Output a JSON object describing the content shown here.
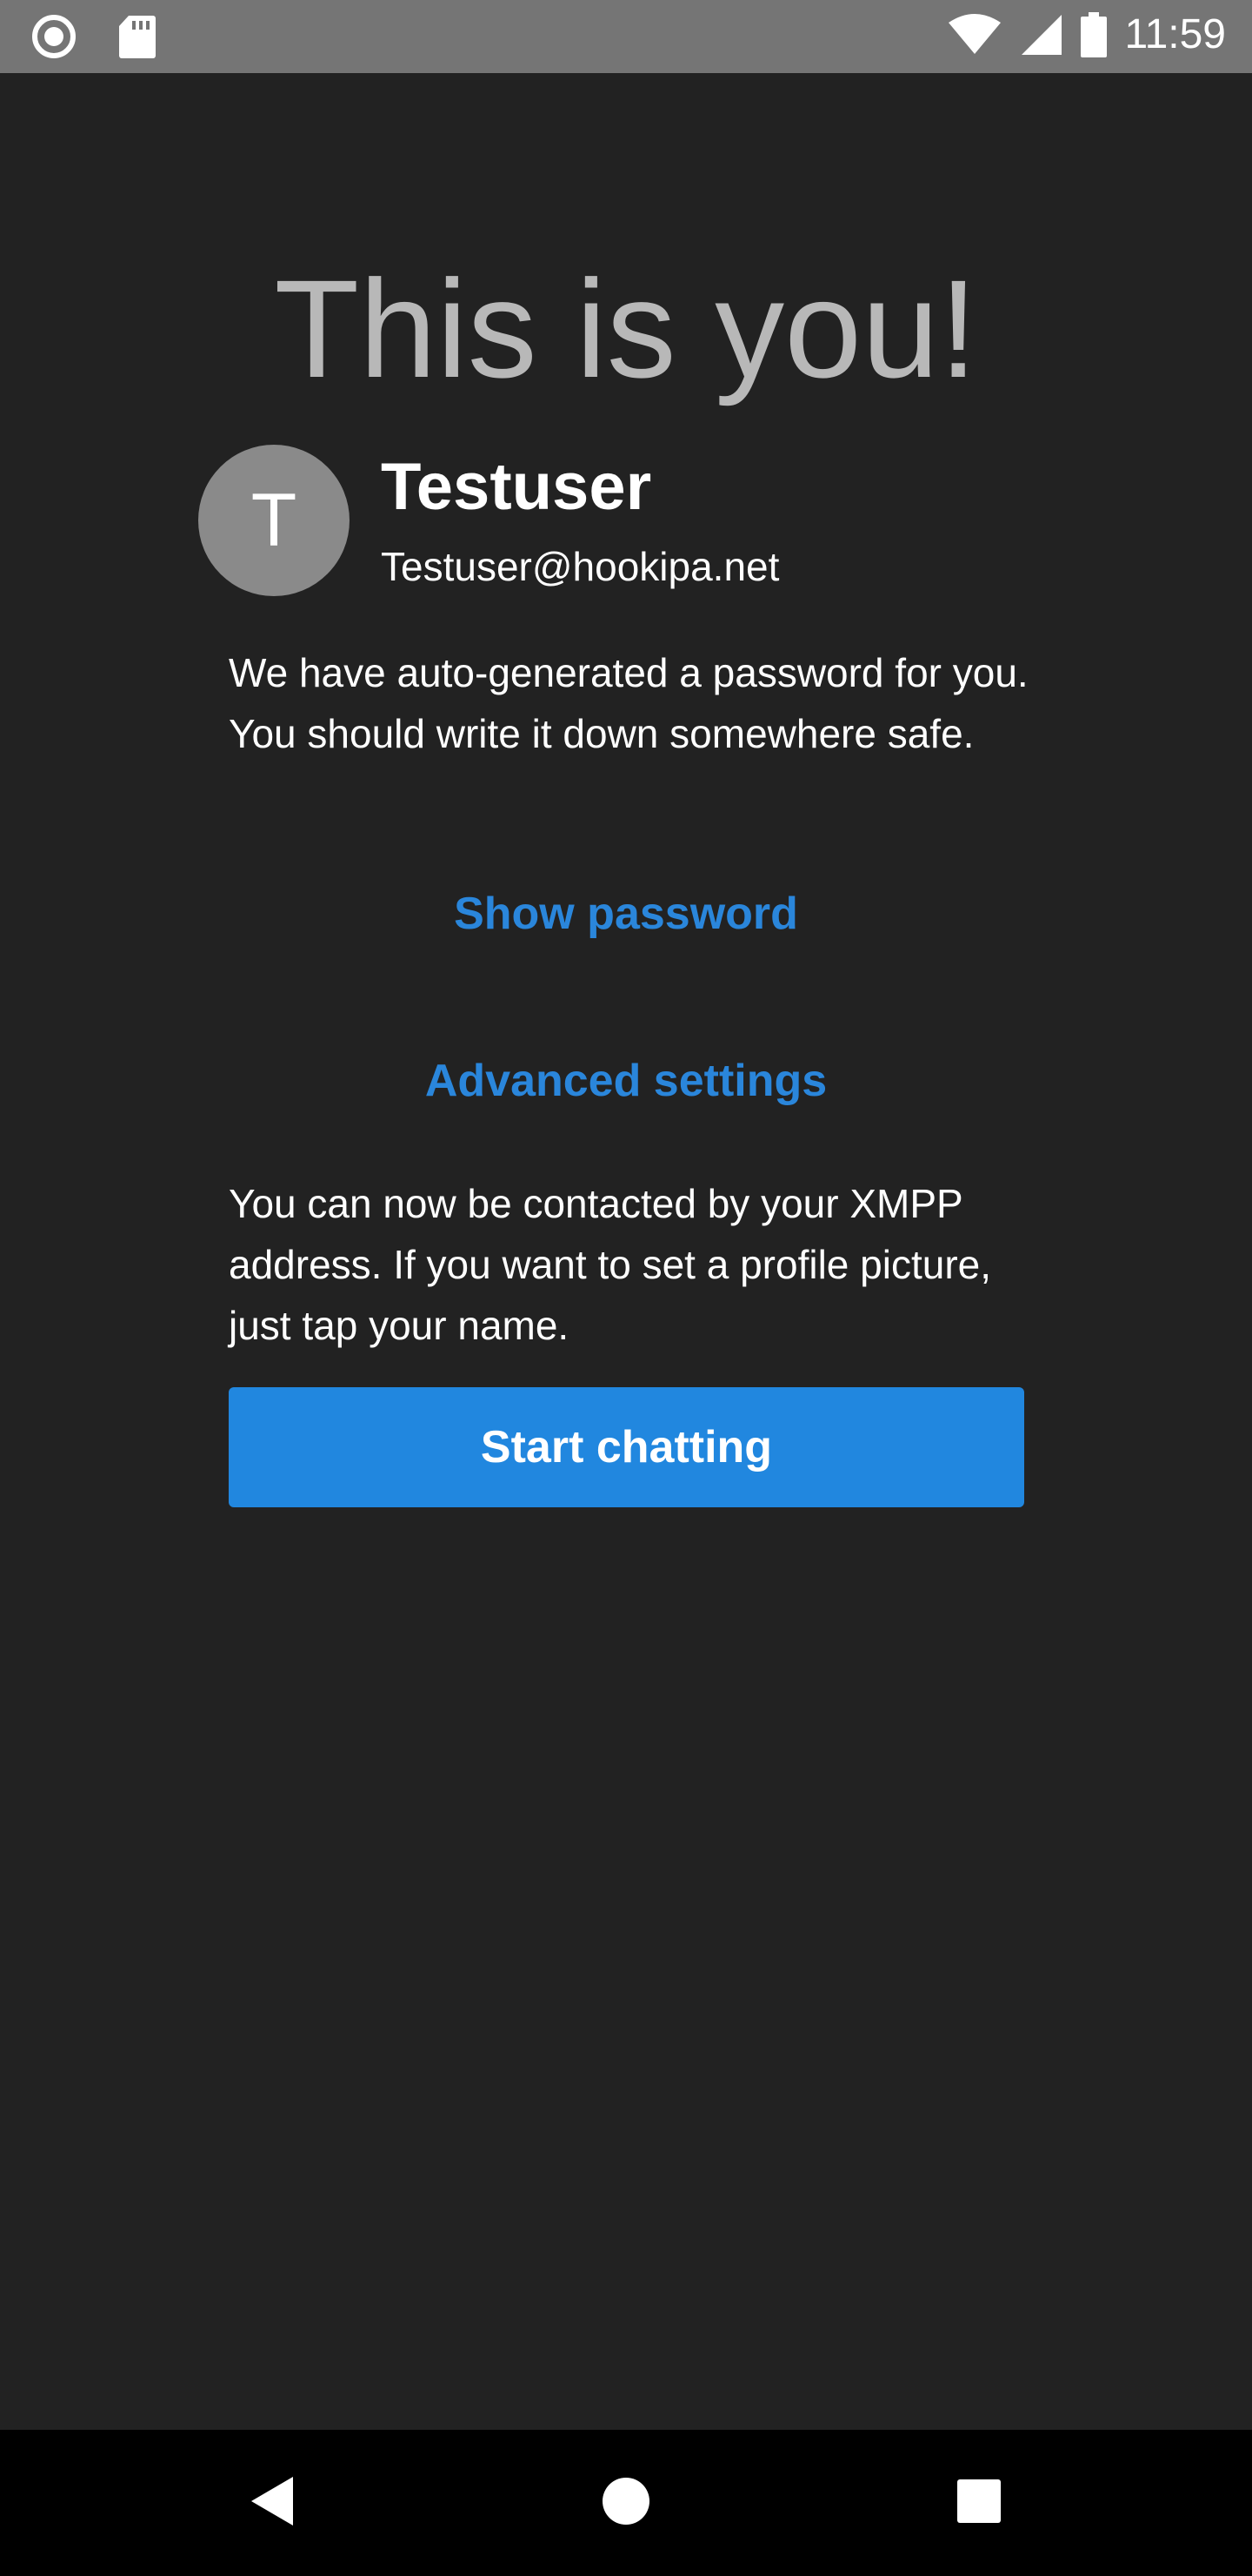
{
  "status_bar": {
    "time": "11:59",
    "icons": [
      "record-icon",
      "sd-card-icon",
      "wifi-icon",
      "signal-icon",
      "battery-icon"
    ]
  },
  "welcome": {
    "title": "This is you!",
    "avatar_letter": "T",
    "username": "Testuser",
    "jid": "Testuser@hookipa.net",
    "password_note": "We have auto-generated a password for you. You should write it down somewhere safe.",
    "show_password_label": "Show password",
    "advanced_settings_label": "Advanced settings",
    "contact_note": "You can now be contacted by your XMPP address. If you want to set a profile picture, just tap your name.",
    "start_chatting_label": "Start chatting"
  },
  "nav_bar": {
    "icons": [
      "back-icon",
      "home-icon",
      "recents-icon"
    ]
  },
  "colors": {
    "background": "#222222",
    "accent": "#2187df",
    "title": "#b8b8b8",
    "avatar": "#8a8a8a"
  }
}
